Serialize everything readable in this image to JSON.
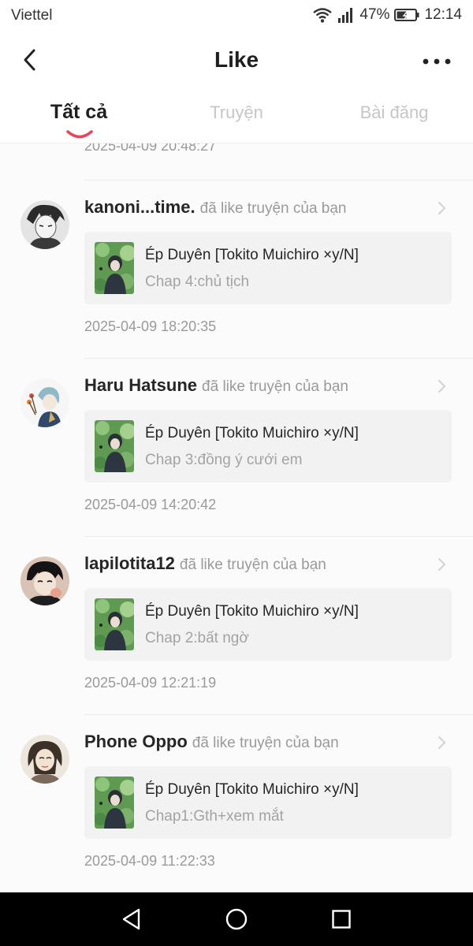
{
  "status_bar": {
    "carrier": "Viettel",
    "battery": "47%",
    "time": "12:14",
    "icons": [
      "wifi-icon",
      "signal-icon",
      "battery-icon"
    ]
  },
  "header": {
    "title": "Like",
    "back_icon": "back-arrow-icon",
    "more_icon": "more-dots-icon"
  },
  "tabs": [
    {
      "label": "Tất cả",
      "active": true
    },
    {
      "label": "Truyện",
      "active": false
    },
    {
      "label": "Bài đăng",
      "active": false
    }
  ],
  "first_item_time": "2025-04-09 20:48:27",
  "items": [
    {
      "user": "kanoni...time.",
      "action": "đã like truyện của bạn",
      "story_title": "Ép Duyên [Tokito Muichiro ×y/N]",
      "chapter": "Chap 4:chủ tịch",
      "time": "2025-04-09 18:20:35"
    },
    {
      "user": "Haru Hatsune",
      "action": "đã like truyện của bạn",
      "story_title": "Ép Duyên [Tokito Muichiro ×y/N]",
      "chapter": "Chap 3:đồng ý cưới em",
      "time": "2025-04-09 14:20:42"
    },
    {
      "user": "lapilotita12",
      "action": "đã like truyện của bạn",
      "story_title": "Ép Duyên [Tokito Muichiro ×y/N]",
      "chapter": "Chap 2:bất ngờ",
      "time": "2025-04-09 12:21:19"
    },
    {
      "user": "Phone Oppo",
      "action": "đã like truyện của bạn",
      "story_title": "Ép Duyên [Tokito Muichiro ×y/N]",
      "chapter": "Chap1:Gth+xem mắt",
      "time": "2025-04-09 11:22:33"
    }
  ],
  "nav_bar": {
    "icons": [
      "back-triangle-icon",
      "home-circle-icon",
      "recents-square-icon"
    ]
  },
  "colors": {
    "accent": "#e8445a",
    "text_primary": "#262626",
    "text_secondary": "#9a9a9a",
    "card_bg": "#f2f2f3",
    "content_bg": "#fbfbfb"
  }
}
